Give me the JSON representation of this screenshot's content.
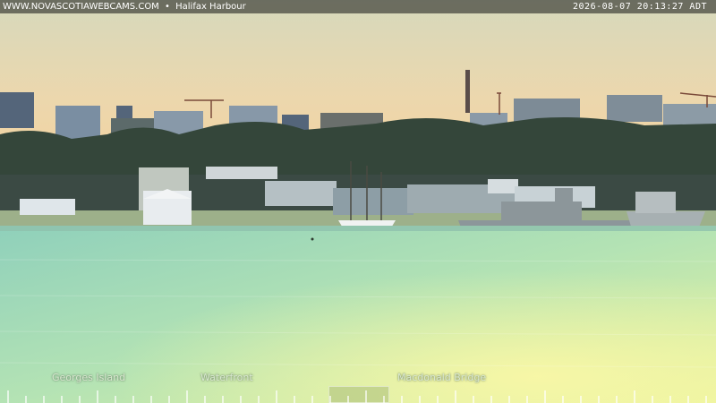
{
  "header": {
    "site": "WWW.NOVASCOTIAWEBCAMS.COM",
    "separator": "•",
    "location": "Halifax Harbour",
    "timestamp": "2026-08-07  20:13:27  ADT"
  },
  "labels": {
    "georges_island": "Georges Island",
    "waterfront": "Waterfront",
    "macdonald_bridge": "Macdonald Bridge"
  },
  "colors": {
    "sky_top": "#d9d8b8",
    "sky_horizon": "#f1d6a6",
    "water": "#a9ddb8",
    "water_glow": "#eef59a",
    "city_shadow": "#2c3a2e"
  }
}
